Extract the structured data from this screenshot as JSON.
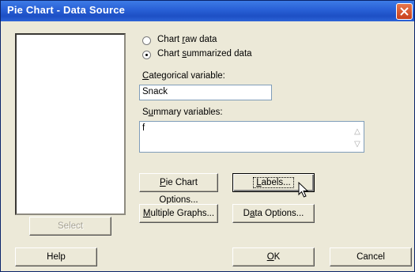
{
  "window": {
    "title": "Pie Chart - Data Source"
  },
  "radios": {
    "raw": {
      "prefix": "Chart ",
      "accel": "r",
      "suffix": "aw data",
      "checked": false
    },
    "summarized": {
      "prefix": "Chart ",
      "accel": "s",
      "suffix": "ummarized data",
      "checked": true
    }
  },
  "categorical": {
    "label_accel": "C",
    "label_rest": "ategorical variable:",
    "value": "Snack"
  },
  "summary": {
    "label_pre": "S",
    "label_accel": "u",
    "label_rest": "mmary variables:",
    "value": "f"
  },
  "buttons": {
    "pie_options": {
      "accel": "P",
      "rest": "ie Chart Options..."
    },
    "labels": {
      "accel": "L",
      "rest": "abels..."
    },
    "multiple_graphs": {
      "accel": "M",
      "rest": "ultiple Graphs..."
    },
    "data_options": {
      "pre": "D",
      "accel": "a",
      "rest": "ta Options..."
    },
    "select": "Select",
    "help": "Help",
    "ok": {
      "accel": "O",
      "rest": "K"
    },
    "cancel": "Cancel"
  },
  "icons": {
    "close": "close-icon",
    "cursor": "mouse-pointer-icon",
    "scroll_up": "scroll-up-icon",
    "scroll_down": "scroll-down-icon"
  },
  "colors": {
    "titlebar": "#2A62D8",
    "close_button": "#D6552B",
    "dialog_face": "#ECE9D8"
  }
}
